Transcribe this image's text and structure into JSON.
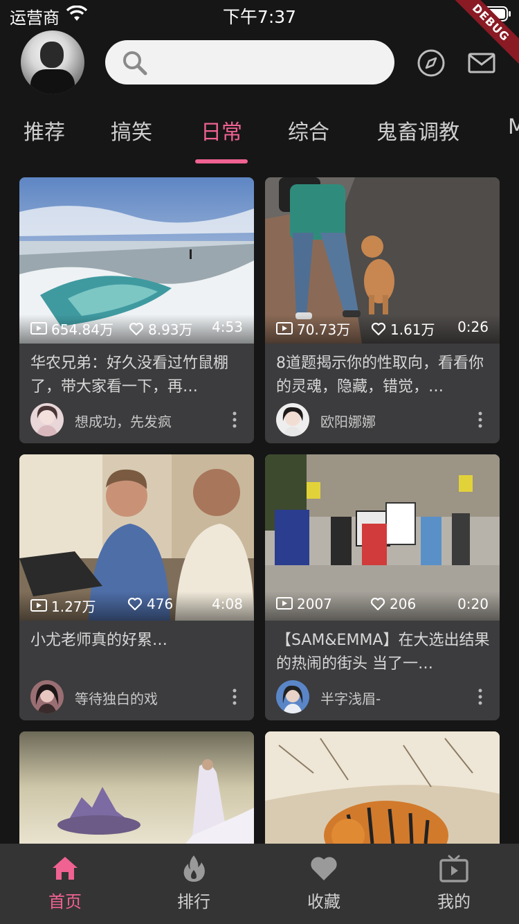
{
  "status_bar": {
    "carrier": "运营商",
    "time": "下午7:37",
    "debug_label": "DEBUG"
  },
  "header": {
    "search_placeholder": "",
    "icons": [
      "avatar",
      "search-icon",
      "compass-icon",
      "mail-icon"
    ]
  },
  "tabs": [
    {
      "label": "推荐",
      "active": false
    },
    {
      "label": "搞笑",
      "active": false
    },
    {
      "label": "日常",
      "active": true
    },
    {
      "label": "综合",
      "active": false
    },
    {
      "label": "鬼畜调教",
      "active": false
    },
    {
      "label": "M",
      "active": false
    }
  ],
  "cards": [
    {
      "views": "654.84万",
      "likes": "8.93万",
      "duration": "4:53",
      "title": "华农兄弟：好久没看过竹鼠棚了，带大家看一下，再…",
      "author": "想成功，先发疯"
    },
    {
      "views": "70.73万",
      "likes": "1.61万",
      "duration": "0:26",
      "title": "8道题揭示你的性取向，看看你的灵魂，隐藏，错觉，…",
      "author": "欧阳娜娜"
    },
    {
      "views": "1.27万",
      "likes": "476",
      "duration": "4:08",
      "title": "小尤老师真的好累…",
      "author": "等待独白的戏"
    },
    {
      "views": "2007",
      "likes": "206",
      "duration": "0:20",
      "title": "【SAM&EMMA】在大选出结果的热闹的街头 当了一…",
      "author": "半字浅眉-"
    }
  ],
  "bottom_nav": [
    {
      "label": "首页",
      "icon": "home-icon",
      "active": true
    },
    {
      "label": "排行",
      "icon": "flame-icon",
      "active": false
    },
    {
      "label": "收藏",
      "icon": "heart-icon",
      "active": false
    },
    {
      "label": "我的",
      "icon": "tv-icon",
      "active": false
    }
  ],
  "colors": {
    "accent": "#f06292",
    "background": "#161616",
    "card": "#3c3c3e",
    "nav": "#343434"
  }
}
